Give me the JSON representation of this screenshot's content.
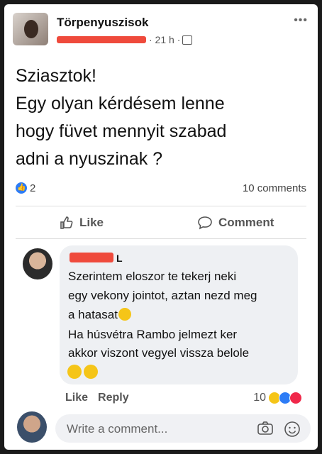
{
  "post": {
    "group_name": "Törpenyuszisok",
    "time": "· 21 h ·",
    "lines": [
      "Sziasztok!",
      "Egy olyan kérdésem lenne",
      "hogy füvet mennyit szabad",
      "adni a nyuszinak ?"
    ],
    "reaction_count": "2",
    "comment_count": "10 comments",
    "like_label": "Like",
    "comment_label": "Comment",
    "icons": [
      "more-icon",
      "audience-icon",
      "like-reaction-icon",
      "thumb-up-icon",
      "comment-icon"
    ]
  },
  "comment": {
    "author_initial": "L",
    "lines": [
      "Szerintem eloszor te tekerj neki",
      "egy vekony jointot, aztan nezd meg",
      "a hatasat",
      "Ha húsvétra Rambo jelmezt ker",
      "akkor viszont vegyel vissza belole"
    ],
    "like_label": "Like",
    "reply_label": "Reply",
    "reaction_count": "10",
    "colors": {
      "haha": "#f5c518",
      "like": "#2d7cf6",
      "love": "#f0284a"
    }
  },
  "composer": {
    "placeholder": "Write a comment...",
    "icons": [
      "camera-icon",
      "smile-icon"
    ]
  },
  "theme": {
    "background": "#1a1a1a",
    "card": "#ffffff",
    "bubble": "#eef0f3",
    "redaction": "#ef4a3c"
  }
}
